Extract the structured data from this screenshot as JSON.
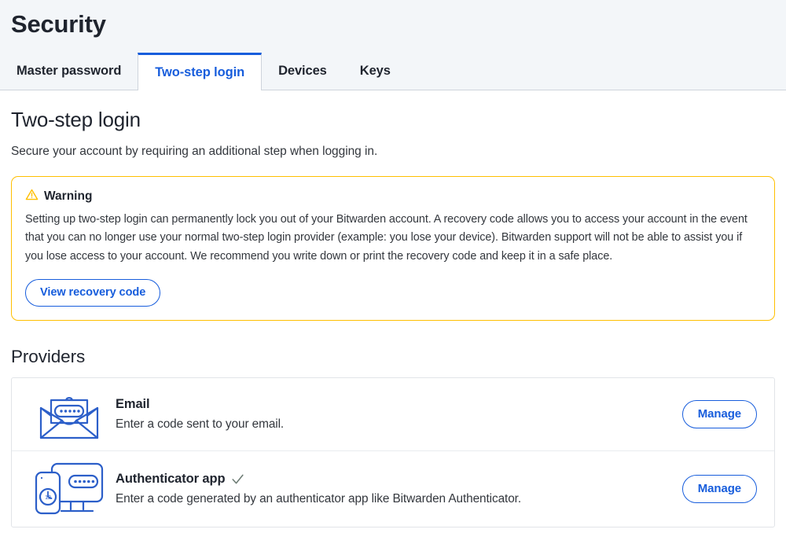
{
  "header": {
    "title": "Security",
    "tabs": [
      {
        "label": "Master password",
        "active": false
      },
      {
        "label": "Two-step login",
        "active": true
      },
      {
        "label": "Devices",
        "active": false
      },
      {
        "label": "Keys",
        "active": false
      }
    ]
  },
  "main": {
    "heading": "Two-step login",
    "subheading": "Secure your account by requiring an additional step when logging in.",
    "warning": {
      "icon": "warning-triangle-icon",
      "title": "Warning",
      "body": "Setting up two-step login can permanently lock you out of your Bitwarden account. A recovery code allows you to access your account in the event that you can no longer use your normal two-step login provider (example: you lose your device). Bitwarden support will not be able to assist you if you lose access to your account. We recommend you write down or print the recovery code and keep it in a safe place.",
      "button_label": "View recovery code"
    },
    "providers_title": "Providers",
    "providers": [
      {
        "icon": "envelope-code-icon",
        "name": "Email",
        "enabled": false,
        "description": "Enter a code sent to your email.",
        "action_label": "Manage"
      },
      {
        "icon": "monitor-phone-code-icon",
        "name": "Authenticator app",
        "enabled": true,
        "enabled_icon": "check-icon",
        "description": "Enter a code generated by an authenticator app like Bitwarden Authenticator.",
        "action_label": "Manage"
      }
    ]
  },
  "colors": {
    "accent": "#175ddc",
    "warning": "#ffbf00",
    "header_bg": "#f3f6f9",
    "text": "#1f242e",
    "border": "#e1e4e8"
  }
}
